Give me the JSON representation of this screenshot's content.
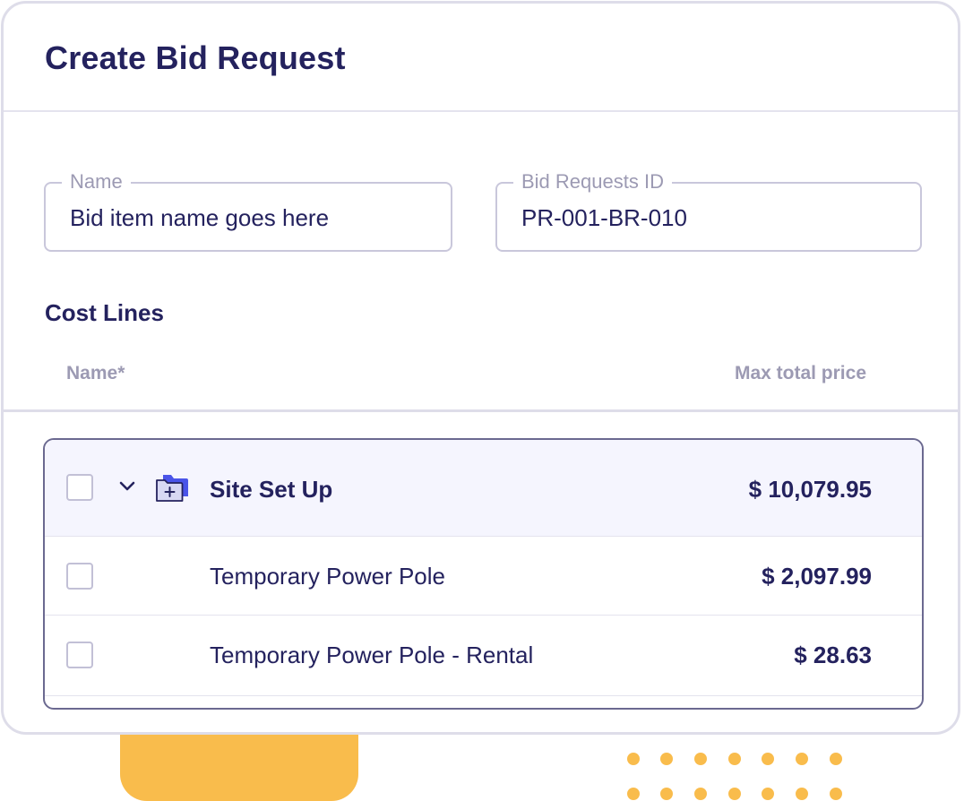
{
  "title": "Create Bid Request",
  "fields": {
    "name": {
      "label": "Name",
      "value": "Bid item name goes here"
    },
    "bid_id": {
      "label": "Bid Requests ID",
      "value": "PR-001-BR-010"
    }
  },
  "cost_lines": {
    "title": "Cost Lines",
    "columns": {
      "name": "Name*",
      "price": "Max total price"
    },
    "group": {
      "name": "Site Set Up",
      "price": "$ 10,079.95",
      "icon": "folder-plus-icon",
      "expanded": true
    },
    "items": [
      {
        "name": "Temporary Power Pole",
        "price": "$ 2,097.99"
      },
      {
        "name": "Temporary Power Pole - Rental",
        "price": "$ 28.63"
      }
    ]
  },
  "colors": {
    "text_primary": "#24225e",
    "text_muted": "#9c9ab3",
    "border": "#dedde9",
    "accent_yellow": "#f9bc4c",
    "folder_blue": "#4a54e8",
    "group_bg": "#f5f5fe"
  }
}
